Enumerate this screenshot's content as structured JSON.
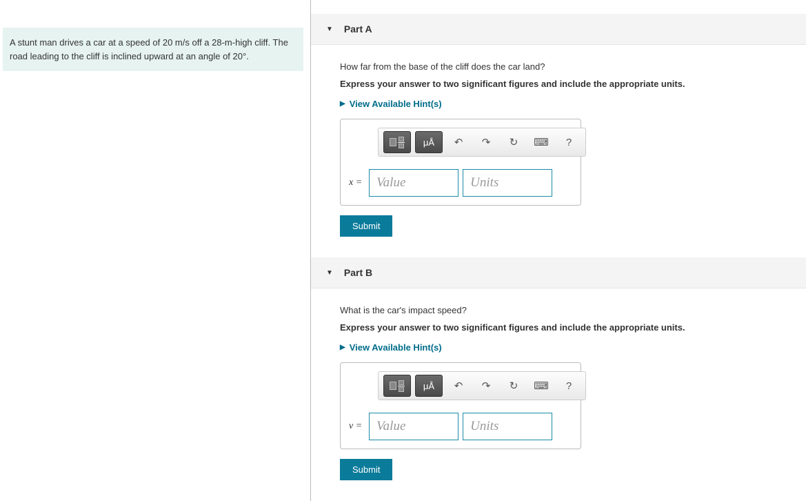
{
  "problem": {
    "text_plain": "A stunt man drives a car at a speed of 20 m/s off a 28-m-high cliff. The road leading to the cliff is inclined upward at an angle of 20°."
  },
  "parts": [
    {
      "title": "Part A",
      "question": "How far from the base of the cliff does the car land?",
      "instruction": "Express your answer to two significant figures and include the appropriate units.",
      "hints_label": "View Available Hint(s)",
      "var_symbol": "x =",
      "value_placeholder": "Value",
      "units_placeholder": "Units",
      "submit_label": "Submit"
    },
    {
      "title": "Part B",
      "question": "What is the car's impact speed?",
      "instruction": "Express your answer to two significant figures and include the appropriate units.",
      "hints_label": "View Available Hint(s)",
      "var_symbol": "v =",
      "value_placeholder": "Value",
      "units_placeholder": "Units",
      "submit_label": "Submit"
    }
  ],
  "toolbar": {
    "units_btn": "μÅ",
    "undo": "↶",
    "redo": "↷",
    "reset": "↻",
    "keyboard": "⌨",
    "help": "?"
  }
}
